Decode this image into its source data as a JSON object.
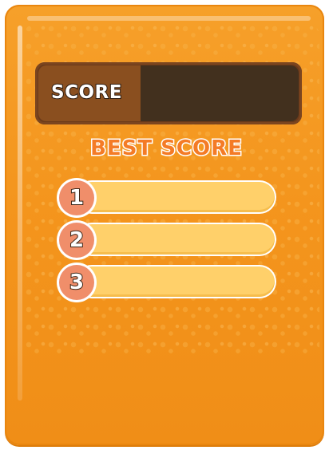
{
  "score": {
    "label": "SCORE",
    "value": ""
  },
  "best_scores": {
    "title": "BEST SCORE",
    "entries": [
      {
        "rank": "1",
        "value": ""
      },
      {
        "rank": "2",
        "value": ""
      },
      {
        "rank": "3",
        "value": ""
      }
    ]
  },
  "colors": {
    "panel": "#f4951d",
    "score_bar": "#6b3a1a",
    "score_value_bg": "#42301e",
    "title": "#f47b26",
    "rank_bar": "#ffd06a",
    "rank_badge": "#f08e6a"
  }
}
